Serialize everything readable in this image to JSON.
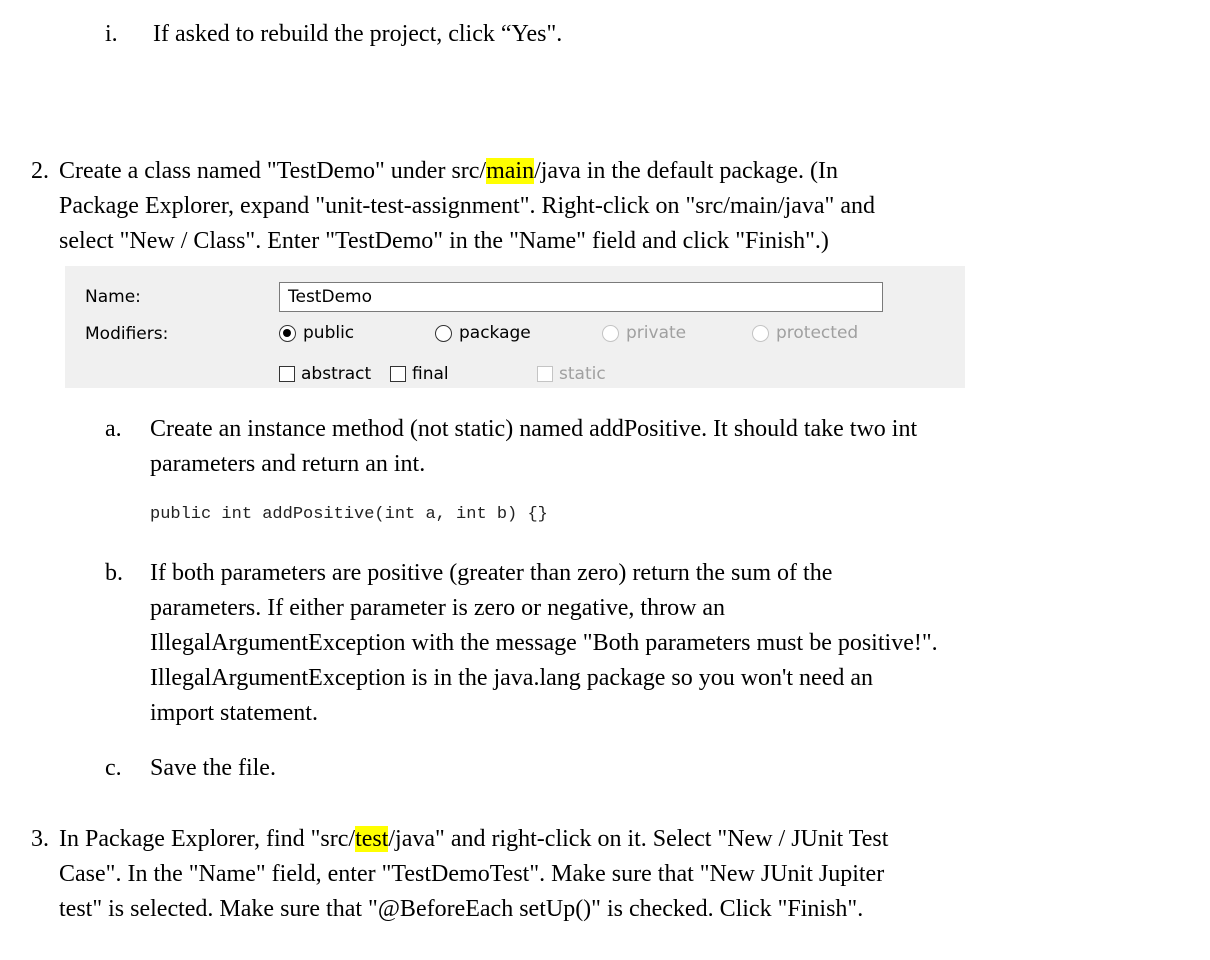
{
  "steps": {
    "step1i": {
      "marker": "i.",
      "text": "If asked to rebuild the project, click “Yes\"."
    },
    "step2": {
      "marker": "2.",
      "line1_pre": "Create a class named \"TestDemo\" under src/",
      "line1_hl": "main",
      "line1_post": "/java in the default package. (In",
      "line2": "Package Explorer, expand \"unit-test-assignment\". Right-click on \"src/main/java\" and",
      "line3": "select \"New / Class\". Enter \"TestDemo\" in the \"Name\" field and click \"Finish\".)"
    },
    "dialog": {
      "name_label": "Name:",
      "name_value": "TestDemo",
      "modifiers_label": "Modifiers:",
      "radios": [
        {
          "label": "public",
          "checked": true,
          "enabled": true
        },
        {
          "label": "package",
          "checked": false,
          "enabled": true
        },
        {
          "label": "private",
          "checked": false,
          "enabled": false
        },
        {
          "label": "protected",
          "checked": false,
          "enabled": false
        }
      ],
      "checkboxes": [
        {
          "label": "abstract",
          "enabled": true
        },
        {
          "label": "final",
          "enabled": true
        },
        {
          "label": "static",
          "enabled": false
        }
      ]
    },
    "step2a": {
      "marker": "a.",
      "line1": "Create an instance method (not static) named addPositive. It should take two int",
      "line2": "parameters and return an int.",
      "code": "public int addPositive(int a, int b) {}"
    },
    "step2b": {
      "marker": "b.",
      "line1": "If both parameters are positive (greater than zero) return the sum of the",
      "line2": "parameters. If either parameter is zero or negative, throw an",
      "line3": "IllegalArgumentException with the message \"Both parameters must be positive!\".",
      "line4": "IllegalArgumentException is in the java.lang package so you won't need an",
      "line5": "import statement."
    },
    "step2c": {
      "marker": "c.",
      "line1": "Save the file."
    },
    "step3": {
      "marker": "3.",
      "line1_pre": "In Package Explorer, find \"src/",
      "line1_hl": "test",
      "line1_post": "/java\" and right-click on it. Select \"New / JUnit Test",
      "line2": "Case\". In the \"Name\" field, enter \"TestDemoTest\". Make sure that \"New JUnit Jupiter",
      "line3": "test\" is selected. Make sure that \"@BeforeEach setUp()\" is checked. Click \"Finish\"."
    }
  },
  "colors": {
    "highlight": "#ffff00",
    "dialog_background": "#f0f0f0",
    "disabled_text": "#a0a0a0"
  }
}
